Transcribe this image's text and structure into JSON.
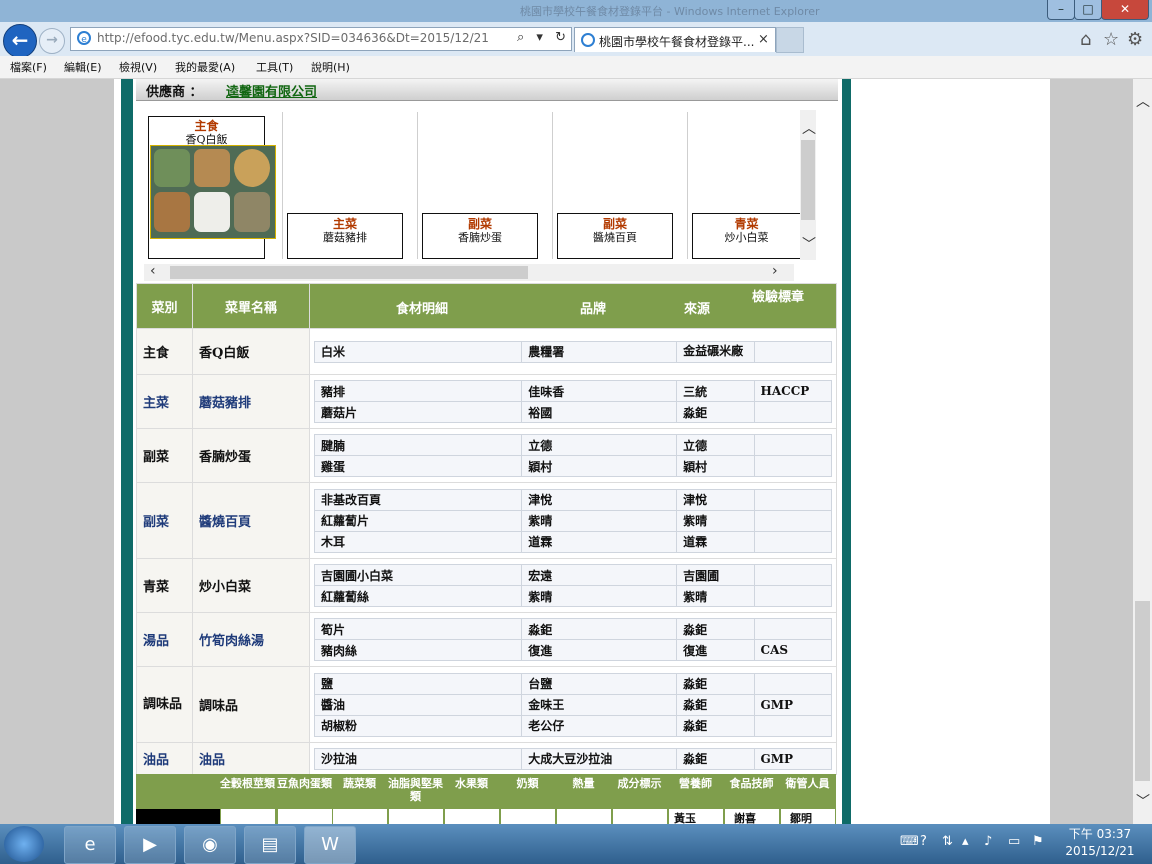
{
  "window": {
    "title_faded": "桃園市學校午餐食材登錄平台 - Windows Internet Explorer",
    "min": "–",
    "max": "□",
    "close": "✕"
  },
  "browser": {
    "url": "http://efood.tyc.edu.tw/Menu.aspx?SID=034636&Dt=2015/12/21",
    "url_controls": "⌕ ▾ ↻",
    "tab_title": "桃園市學校午餐食材登錄平...",
    "tab_close": "×",
    "icons": [
      "home-icon",
      "star-icon",
      "gear-icon"
    ],
    "back": "←",
    "forward": "→"
  },
  "menubar": [
    "檔案(F)",
    "編輯(E)",
    "檢視(V)",
    "我的最愛(A)",
    "工具(T)",
    "說明(H)"
  ],
  "supplier": {
    "label": "供應商 ：",
    "name": "逵馨園有限公司"
  },
  "gallery": [
    {
      "category": "主食",
      "name": "香Q白飯"
    },
    {
      "category": "主菜",
      "name": "蘑菇豬排"
    },
    {
      "category": "副菜",
      "name": "香腩炒蛋"
    },
    {
      "category": "副菜",
      "name": "醬燒百頁"
    },
    {
      "category": "青菜",
      "name": "炒小白菜"
    }
  ],
  "table": {
    "headers": {
      "category": "菜別",
      "dish": "菜單名稱",
      "ingredient": "食材明細",
      "brand": "品牌",
      "source": "來源",
      "cert": "檢驗標章"
    },
    "rows": [
      {
        "category": "主食",
        "dish": "香Q白飯",
        "blue": false,
        "items": [
          {
            "ingredient": "白米",
            "brand": "農糧署",
            "source": "金益碾米廠",
            "cert": ""
          }
        ]
      },
      {
        "category": "主菜",
        "dish": "蘑菇豬排",
        "blue": true,
        "items": [
          {
            "ingredient": "豬排",
            "brand": "佳味香",
            "source": "三統",
            "cert": "HACCP"
          },
          {
            "ingredient": "蘑菇片",
            "brand": "裕國",
            "source": "淼鉅",
            "cert": ""
          }
        ]
      },
      {
        "category": "副菜",
        "dish": "香腩炒蛋",
        "blue": false,
        "items": [
          {
            "ingredient": "腱腩",
            "brand": "立德",
            "source": "立德",
            "cert": ""
          },
          {
            "ingredient": "雞蛋",
            "brand": "穎村",
            "source": "穎村",
            "cert": ""
          }
        ]
      },
      {
        "category": "副菜",
        "dish": "醬燒百頁",
        "blue": true,
        "items": [
          {
            "ingredient": "非基改百頁",
            "brand": "津悅",
            "source": "津悅",
            "cert": ""
          },
          {
            "ingredient": "紅蘿蔔片",
            "brand": "紫晴",
            "source": "紫晴",
            "cert": ""
          },
          {
            "ingredient": "木耳",
            "brand": "道霖",
            "source": "道霖",
            "cert": ""
          }
        ]
      },
      {
        "category": "青菜",
        "dish": "炒小白菜",
        "blue": false,
        "items": [
          {
            "ingredient": "吉園圃小白菜",
            "brand": "宏遠",
            "source": "吉園圃",
            "cert": ""
          },
          {
            "ingredient": "紅蘿蔔絲",
            "brand": "紫晴",
            "source": "紫晴",
            "cert": ""
          }
        ]
      },
      {
        "category": "湯品",
        "dish": "竹筍肉絲湯",
        "blue": true,
        "items": [
          {
            "ingredient": "筍片",
            "brand": "淼鉅",
            "source": "淼鉅",
            "cert": ""
          },
          {
            "ingredient": "豬肉絲",
            "brand": "復進",
            "source": "復進",
            "cert": "CAS"
          }
        ]
      },
      {
        "category": "調味品",
        "dish": "調味品",
        "blue": false,
        "items": [
          {
            "ingredient": "鹽",
            "brand": "台鹽",
            "source": "淼鉅",
            "cert": ""
          },
          {
            "ingredient": "醬油",
            "brand": "金味王",
            "source": "淼鉅",
            "cert": "GMP"
          },
          {
            "ingredient": "胡椒粉",
            "brand": "老公仔",
            "source": "淼鉅",
            "cert": ""
          }
        ]
      },
      {
        "category": "油品",
        "dish": "油品",
        "blue": true,
        "items": [
          {
            "ingredient": "沙拉油",
            "brand": "大成大豆沙拉油",
            "source": "淼鉅",
            "cert": "GMP"
          }
        ]
      }
    ]
  },
  "nutrition": {
    "headers": [
      "全穀根莖類",
      "豆魚肉蛋類",
      "蔬菜類",
      "油脂與堅果類",
      "水果類",
      "奶類",
      "熱量",
      "成分標示",
      "營養師",
      "食品技師",
      "衛管人員"
    ],
    "partial_values": {
      "nutritionist": "黃玉",
      "technician": "謝喜",
      "health": "鄒明"
    }
  },
  "taskbar": {
    "time": "下午 03:37",
    "date": "2015/12/21",
    "apps": [
      "ie-icon",
      "media-player-icon",
      "chrome-icon",
      "explorer-icon",
      "word-icon"
    ]
  }
}
